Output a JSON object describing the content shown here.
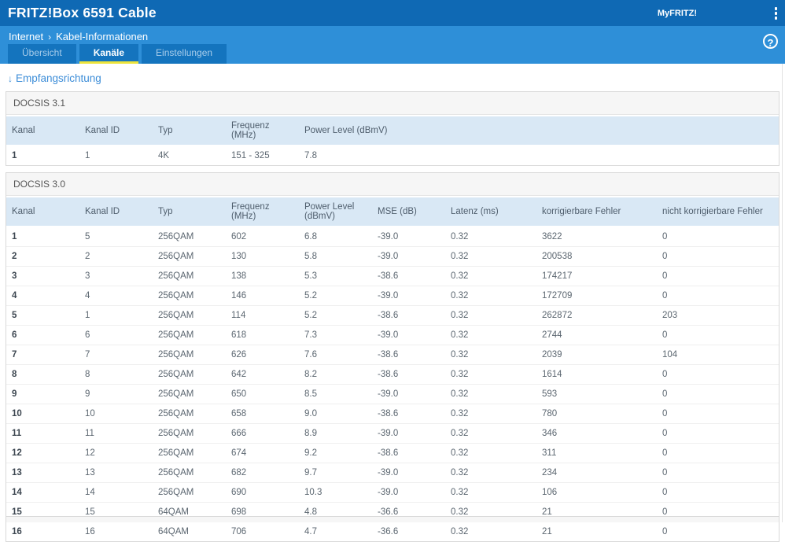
{
  "header": {
    "title": "FRITZ!Box 6591 Cable",
    "myfritz_label": "MyFRITZ!"
  },
  "breadcrumb": {
    "section": "Internet",
    "separator": "›",
    "page": "Kabel-Informationen"
  },
  "tabs": [
    {
      "label": "Übersicht",
      "active": false
    },
    {
      "label": "Kanäle",
      "active": true
    },
    {
      "label": "Einstellungen",
      "active": false
    }
  ],
  "help_icon": "?",
  "direction_link": {
    "arrow": "↓",
    "label": "Empfangsrichtung"
  },
  "tables": [
    {
      "section": "DOCSIS 3.1",
      "columns": [
        "Kanal",
        "Kanal ID",
        "Typ",
        "Frequenz (MHz)",
        "Power Level (dBmV)"
      ],
      "rows": [
        [
          "1",
          "1",
          "4K",
          "151 - 325",
          "7.8"
        ]
      ]
    },
    {
      "section": "DOCSIS 3.0",
      "columns": [
        "Kanal",
        "Kanal ID",
        "Typ",
        "Frequenz (MHz)",
        "Power Level (dBmV)",
        "MSE (dB)",
        "Latenz (ms)",
        "korrigierbare Fehler",
        "nicht korrigierbare Fehler"
      ],
      "rows": [
        [
          "1",
          "5",
          "256QAM",
          "602",
          "6.8",
          "-39.0",
          "0.32",
          "3622",
          "0"
        ],
        [
          "2",
          "2",
          "256QAM",
          "130",
          "5.8",
          "-39.0",
          "0.32",
          "200538",
          "0"
        ],
        [
          "3",
          "3",
          "256QAM",
          "138",
          "5.3",
          "-38.6",
          "0.32",
          "174217",
          "0"
        ],
        [
          "4",
          "4",
          "256QAM",
          "146",
          "5.2",
          "-39.0",
          "0.32",
          "172709",
          "0"
        ],
        [
          "5",
          "1",
          "256QAM",
          "114",
          "5.2",
          "-38.6",
          "0.32",
          "262872",
          "203"
        ],
        [
          "6",
          "6",
          "256QAM",
          "618",
          "7.3",
          "-39.0",
          "0.32",
          "2744",
          "0"
        ],
        [
          "7",
          "7",
          "256QAM",
          "626",
          "7.6",
          "-38.6",
          "0.32",
          "2039",
          "104"
        ],
        [
          "8",
          "8",
          "256QAM",
          "642",
          "8.2",
          "-38.6",
          "0.32",
          "1614",
          "0"
        ],
        [
          "9",
          "9",
          "256QAM",
          "650",
          "8.5",
          "-39.0",
          "0.32",
          "593",
          "0"
        ],
        [
          "10",
          "10",
          "256QAM",
          "658",
          "9.0",
          "-38.6",
          "0.32",
          "780",
          "0"
        ],
        [
          "11",
          "11",
          "256QAM",
          "666",
          "8.9",
          "-39.0",
          "0.32",
          "346",
          "0"
        ],
        [
          "12",
          "12",
          "256QAM",
          "674",
          "9.2",
          "-38.6",
          "0.32",
          "311",
          "0"
        ],
        [
          "13",
          "13",
          "256QAM",
          "682",
          "9.7",
          "-39.0",
          "0.32",
          "234",
          "0"
        ],
        [
          "14",
          "14",
          "256QAM",
          "690",
          "10.3",
          "-39.0",
          "0.32",
          "106",
          "0"
        ],
        [
          "15",
          "15",
          "64QAM",
          "698",
          "4.8",
          "-36.6",
          "0.32",
          "21",
          "0"
        ],
        [
          "16",
          "16",
          "64QAM",
          "706",
          "4.7",
          "-36.6",
          "0.32",
          "21",
          "0"
        ]
      ]
    }
  ],
  "colors": {
    "titlebar_bg": "#0F69B4",
    "subbar_bg": "#2E8FD8",
    "tab_bg": "#1474BE",
    "active_tab_underline": "#EDE43C",
    "link_blue": "#3E8ED8",
    "table_header_bg": "#D9E8F5",
    "section_header_bg": "#F6F6F6"
  }
}
